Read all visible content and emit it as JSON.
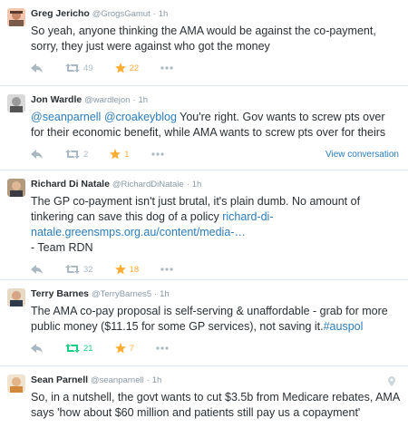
{
  "tweets": [
    {
      "name": "Greg Jericho",
      "handle": "@GrogsGamut",
      "time": "1h",
      "text": "So yeah, anyone thinking the AMA would be against the co-payment, sorry, they just were against who got the money",
      "retweets": "49",
      "favorites": "22"
    },
    {
      "name": "Jon Wardle",
      "handle": "@wardlejon",
      "time": "1h",
      "mention1": "@seanparnell",
      "mention2": "@croakeyblog",
      "text": " You're right. Gov wants to screw pts over for their economic benefit, while AMA wants to screw pts over for theirs",
      "retweets": "2",
      "favorites": "1",
      "view_conversation": "View conversation"
    },
    {
      "name": "Richard Di Natale",
      "handle": "@RichardDiNatale",
      "time": "1h",
      "text": "The GP co-payment isn't just brutal, it's plain dumb. No amount of tinkering can save this dog of a policy ",
      "link": "richard-di-natale.greensmps.org.au/content/media-…",
      "sign": "- Team RDN",
      "retweets": "32",
      "favorites": "18"
    },
    {
      "name": "Terry Barnes",
      "handle": "@TerryBarnes5",
      "time": "1h",
      "text": "The AMA co-pay proposal is self-serving & unaffordable - grab for more public money ($11.15 for some GP services), not saving it.",
      "hashtag": "#auspol",
      "retweets": "21",
      "favorites": "7"
    },
    {
      "name": "Sean Parnell",
      "handle": "@seanparnell",
      "time": "1h",
      "text": "So, in a nutshell, the govt wants to cut $3.5b from Medicare rebates, AMA says 'how about $60 million and patients still pay us a copayment'"
    }
  ],
  "colors": {
    "link": "#2b7bb9",
    "favorite": "#ffac33",
    "retweet": "#19cf86",
    "muted": "#aab8c2"
  },
  "icons": [
    "reply-icon",
    "retweet-icon",
    "favorite-icon",
    "more-icon",
    "location-icon"
  ]
}
